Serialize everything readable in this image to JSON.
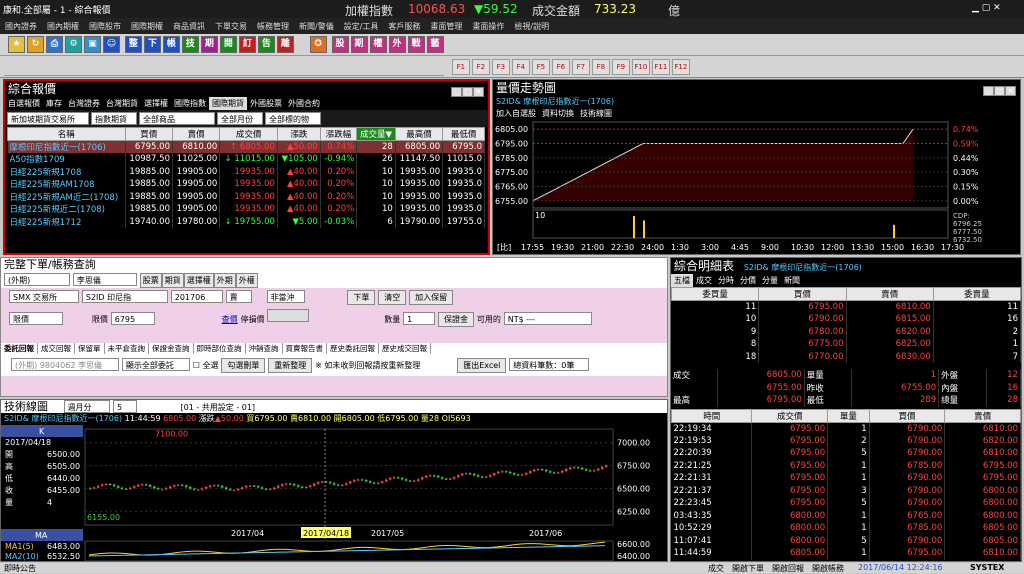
{
  "titlebar": {
    "app_title": "康和.全部屬 - 1 - 綜合報價",
    "index_label": "加權指數",
    "index_value": "10068.63",
    "index_change": "▼59.52",
    "turnover_label": "成交金額",
    "turnover_value": "733.23",
    "turnover_unit": "億"
  },
  "menu": [
    "國內證券",
    "國內期權",
    "國際股市",
    "國際期權",
    "商品資訊",
    "下單交易",
    "帳務管理",
    "新聞/警儀",
    "設定/工具",
    "客戶服務",
    "畫面管理",
    "畫面操作",
    "檢視/說明"
  ],
  "toolbar": {
    "icons": [
      {
        "label": "整",
        "color": "#2050c0"
      },
      {
        "label": "下",
        "color": "#2050c0"
      },
      {
        "label": "帳",
        "color": "#2050c0"
      },
      {
        "label": "技",
        "color": "#1a8a1a"
      },
      {
        "label": "期",
        "color": "#a02090"
      },
      {
        "label": "閱",
        "color": "#1a8a1a"
      },
      {
        "label": "訂",
        "color": "#c02020"
      },
      {
        "label": "告",
        "color": "#1a8a1a"
      },
      {
        "label": "離",
        "color": "#c02020"
      }
    ],
    "icons2": [
      "股",
      "期",
      "權",
      "外",
      "戰",
      "藝"
    ],
    "fkeys": [
      "F1",
      "F2",
      "F3",
      "F4",
      "F5",
      "F6",
      "F7",
      "F8",
      "F9",
      "F10",
      "F11",
      "F12"
    ]
  },
  "quote_panel": {
    "title": "綜合報價",
    "tabs": [
      "自選報價",
      "庫存",
      "台灣證券",
      "台灣期貨",
      "選擇權",
      "國際指數",
      "國際期貨",
      "外國股票",
      "外國合約"
    ],
    "active_tab": "國際期貨",
    "filters": [
      "新加坡期貨交易所",
      "指數期貨",
      "全部商品",
      "全部月份",
      "全部標的物"
    ],
    "headers": [
      "名稱",
      "買價",
      "賣價",
      "成交價",
      "漲跌",
      "漲跌幅",
      "成交量▼",
      "最高價",
      "最低價"
    ],
    "rows": [
      {
        "name": "摩根印尼指數近一(1706)",
        "bid": "6795.00",
        "ask": "6810.00",
        "last": "↑ 6805.00",
        "chg": "▲50.00",
        "pct": "0.74%",
        "vol": "28",
        "high": "6805.00",
        "low": "6795.0",
        "dir": "up",
        "selected": true
      },
      {
        "name": "A50指數1709",
        "bid": "10987.50",
        "ask": "11025.00",
        "last": "↓ 11015.00",
        "chg": "▼105.00",
        "pct": "-0.94%",
        "vol": "26",
        "high": "11147.50",
        "low": "11015.0",
        "dir": "down"
      },
      {
        "name": "日經225新規1708",
        "bid": "19885.00",
        "ask": "19905.00",
        "last": "19935.00",
        "chg": "▲40.00",
        "pct": "0.20%",
        "vol": "10",
        "high": "19935.00",
        "low": "19935.0",
        "dir": "up"
      },
      {
        "name": "日經225新規AM1708",
        "bid": "19885.00",
        "ask": "19905.00",
        "last": "19935.00",
        "chg": "▲40.00",
        "pct": "0.20%",
        "vol": "10",
        "high": "19935.00",
        "low": "19935.0",
        "dir": "up"
      },
      {
        "name": "日經225新規AM近二(1708)",
        "bid": "19885.00",
        "ask": "19905.00",
        "last": "19935.00",
        "chg": "▲40.00",
        "pct": "0.20%",
        "vol": "10",
        "high": "19935.00",
        "low": "19935.0",
        "dir": "up"
      },
      {
        "name": "日經225新規近二(1708)",
        "bid": "19885.00",
        "ask": "19905.00",
        "last": "19935.00",
        "chg": "▲40.00",
        "pct": "0.20%",
        "vol": "10",
        "high": "19935.00",
        "low": "19935.0",
        "dir": "up"
      },
      {
        "name": "日經225新規1712",
        "bid": "19740.00",
        "ask": "19780.00",
        "last": "↓ 19755.00",
        "chg": "▼5.00",
        "pct": "-0.03%",
        "vol": "6",
        "high": "19790.00",
        "low": "19755.0",
        "dir": "down"
      }
    ]
  },
  "intraday": {
    "title": "量價走勢圖",
    "symbol": "S2ID&  摩根印尼指數近一(1706)",
    "menu": [
      "加入自選股",
      "資料切換",
      "技術線圖"
    ],
    "yticks": [
      "6805.00",
      "6795.00",
      "6785.00",
      "6775.00",
      "6765.00",
      "6755.00"
    ],
    "pct_ticks": [
      "0.74%",
      "0.59%",
      "0.44%",
      "0.30%",
      "0.15%",
      "0.00%"
    ],
    "xticks": [
      "17:55",
      "19:30",
      "21:00",
      "22:30",
      "24:00",
      "1:30",
      "3:00",
      "4:45",
      "9:00",
      "10:30",
      "12:00",
      "13:30",
      "15:00",
      "16:30",
      "17:30"
    ],
    "vol_label": "10",
    "cdp": [
      "CDP:",
      "6796.25",
      "6777.50",
      "6732.50"
    ],
    "xlabel_left": "[比]"
  },
  "order": {
    "title": "完整下單/帳務查詢",
    "account": "(外期)",
    "filter": "李思儀",
    "tabs_top": [
      "股票",
      "期貨",
      "選擇權",
      "外期",
      "外權"
    ],
    "exchange": "SMX 交易所",
    "symbol": "S2ID  印尼指",
    "month": "201706",
    "side": "賣",
    "offset": "非當沖",
    "btn_order": "下單",
    "btn_clear": "清空",
    "btn_add": "加入保留",
    "price_type": "限價",
    "price_label": "限價",
    "price": "6795",
    "query": "查價",
    "stop_label": "停損價",
    "qty_label": "數量",
    "qty": "1",
    "margin_btn": "保證金",
    "available_label": "可用的",
    "available": "NT$ ---",
    "subtabs": [
      "委託回報",
      "成交回報",
      "保留單",
      "未平倉查詢",
      "保證金查詢",
      "即時部位查詢",
      "沖銷查詢",
      "買賣報告書",
      "歷史委託回報",
      "歷史成交回報"
    ],
    "acct2": "(外期)  9804062 李思儀",
    "show_all": "顯示全部委託",
    "check_all": "全選",
    "btn_cancel": "勾選刪單",
    "btn_refresh": "重新整理",
    "note": "※ 如未收到回報請按重新整理",
    "btn_excel": "匯出Excel",
    "total": "總資料筆數：0筆"
  },
  "tech": {
    "title": "技術線圖",
    "period": "週月分",
    "chart_set": "[01 - 共用設定 - 01]",
    "symbol": "S2ID&  摩根印尼指數近一(1706)",
    "time": "11:44:59",
    "last": "6805.00",
    "chg_label": "漲跌",
    "chg": "▲50.00",
    "bid": "買6795.00",
    "ask": "賣6810.00",
    "open": "開6805.00",
    "low": "低6795.00",
    "vol": "量28",
    "oi": "OI5693",
    "k_label": "K",
    "k_date": "2017/04/18",
    "k_vals": [
      [
        "開",
        "6500.00"
      ],
      [
        "高",
        "6505.00"
      ],
      [
        "低",
        "6440.00"
      ],
      [
        "收",
        "6455.00"
      ],
      [
        "量",
        "4"
      ]
    ],
    "ma_label": "MA",
    "ma1": "MA1(5)",
    "ma1v": "6483.00",
    "ma2": "MA2(10)",
    "ma2v": "6532.50",
    "yticks": [
      "7000.00",
      "6750.00",
      "6500.00",
      "6250.00"
    ],
    "ma_yticks": [
      "6600.00",
      "6400.00"
    ],
    "hi_mark": "7100.00",
    "lo_mark": "6155.00",
    "xticks": [
      "2017/04",
      "2017/04/18",
      "2017/05",
      "2017/06"
    ]
  },
  "detail": {
    "title": "綜合明細表",
    "symbol": "S2ID&  摩根印尼指數近一(1706)",
    "tabs": [
      "五檔",
      "成交",
      "分時",
      "分價",
      "分量",
      "新聞"
    ],
    "headers": [
      "委買量",
      "買價",
      "賣價",
      "委賣量"
    ],
    "levels": [
      [
        "11",
        "6795.00",
        "6810.00",
        "11"
      ],
      [
        "10",
        "6790.00",
        "6815.00",
        "16"
      ],
      [
        "9",
        "6780.00",
        "6820.00",
        "2"
      ],
      [
        "8",
        "6775.00",
        "6825.00",
        "1"
      ],
      [
        "18",
        "6770.00",
        "6830.00",
        "7"
      ]
    ],
    "stats": [
      [
        "成交",
        "6805.00",
        "單量",
        "1",
        "外盤",
        "12"
      ],
      [
        "",
        "6755.00",
        "昨收",
        "6755.00",
        "內盤",
        "16"
      ],
      [
        "最高",
        "6795.00",
        "最低",
        "289",
        "總量",
        "28"
      ]
    ],
    "tick_headers": [
      "時間",
      "成交價",
      "單量",
      "買價",
      "賣價"
    ],
    "ticks": [
      [
        "22:19:34",
        "6795.00",
        "1",
        "6790.00",
        "6810.00"
      ],
      [
        "22:19:53",
        "6795.00",
        "2",
        "6790.00",
        "6820.00"
      ],
      [
        "22:20:39",
        "6795.00",
        "5",
        "6790.00",
        "6810.00"
      ],
      [
        "22:21:25",
        "6795.00",
        "1",
        "6785.00",
        "6795.00"
      ],
      [
        "22:21:31",
        "6795.00",
        "1",
        "6790.00",
        "6795.00"
      ],
      [
        "22:21:37",
        "6795.00",
        "3",
        "6790.00",
        "6800.00"
      ],
      [
        "22:23:45",
        "6795.00",
        "5",
        "6790.00",
        "6800.00"
      ],
      [
        "03:43:35",
        "6800.00",
        "1",
        "6765.00",
        "6800.00"
      ],
      [
        "10:52:29",
        "6800.00",
        "1",
        "6785.00",
        "6805.00"
      ],
      [
        "11:07:41",
        "6800.00",
        "5",
        "6790.00",
        "6805.00"
      ],
      [
        "11:44:59",
        "6805.00",
        "1",
        "6795.00",
        "6810.00"
      ]
    ]
  },
  "status": {
    "left": "即時公告",
    "items": [
      "成交",
      "開啟下單",
      "開啟回報",
      "開啟帳務"
    ],
    "datetime": "2017/06/14 12:24:16",
    "brand": "SYSTEX"
  },
  "chart_data": [
    {
      "type": "line",
      "name": "intraday",
      "x": [
        "17:55",
        "22:30",
        "10:30",
        "11:44"
      ],
      "values": [
        6755,
        6795,
        6795,
        6805
      ],
      "ylim": [
        6750,
        6810
      ]
    },
    {
      "type": "line",
      "name": "weekly-k",
      "hi": 7100,
      "lo": 6155,
      "ylim": [
        6100,
        7150
      ]
    }
  ]
}
